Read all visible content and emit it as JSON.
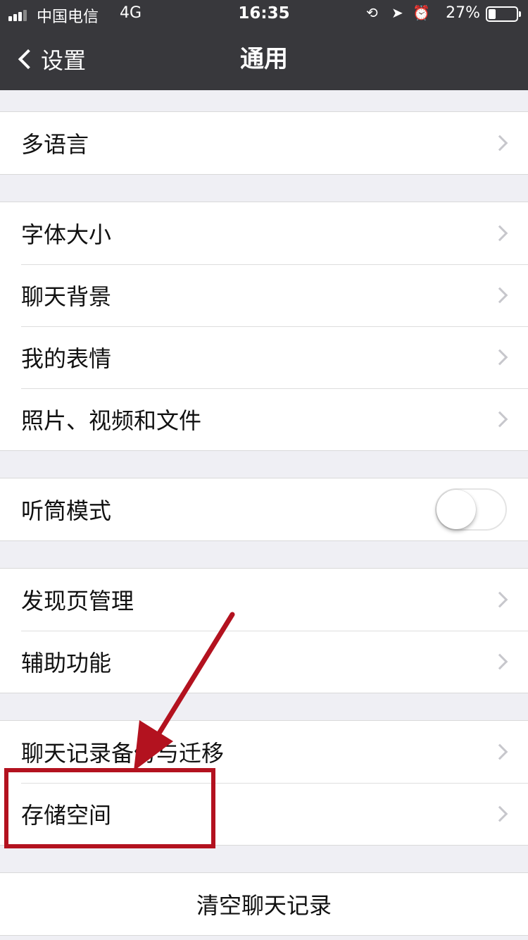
{
  "status_bar": {
    "carrier": "中国电信",
    "network": "4G",
    "time": "16:35",
    "battery_percent": "27%",
    "battery_level": 0.27,
    "icons": [
      "orientation-lock-icon",
      "location-icon",
      "alarm-icon"
    ]
  },
  "nav": {
    "back_label": "设置",
    "title": "通用"
  },
  "groups": [
    {
      "items": [
        {
          "label": "多语言"
        }
      ]
    },
    {
      "items": [
        {
          "label": "字体大小"
        },
        {
          "label": "聊天背景"
        },
        {
          "label": "我的表情"
        },
        {
          "label": "照片、视频和文件"
        }
      ]
    },
    {
      "items": [
        {
          "label": "听筒模式",
          "toggle": false
        }
      ]
    },
    {
      "items": [
        {
          "label": "发现页管理"
        },
        {
          "label": "辅助功能"
        }
      ]
    },
    {
      "items": [
        {
          "label": "聊天记录备份与迁移"
        },
        {
          "label": "存储空间"
        }
      ]
    }
  ],
  "clear_chat": {
    "label": "清空聊天记录"
  },
  "colors": {
    "nav_background": "#38383c",
    "page_background": "#efeff4",
    "annotation": "#b3121f"
  }
}
